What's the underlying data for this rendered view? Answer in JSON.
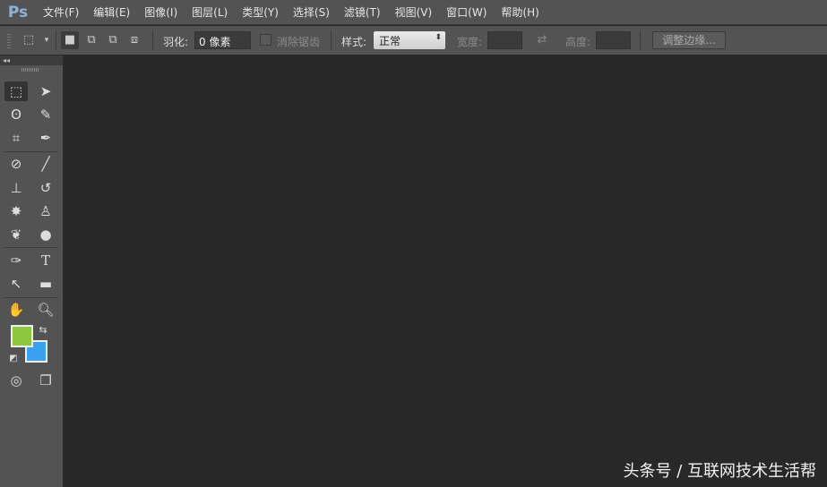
{
  "app": {
    "logo": "Ps"
  },
  "menu": [
    "文件(F)",
    "编辑(E)",
    "图像(I)",
    "图层(L)",
    "类型(Y)",
    "选择(S)",
    "滤镜(T)",
    "视图(V)",
    "窗口(W)",
    "帮助(H)"
  ],
  "options": {
    "feather_label": "羽化:",
    "feather_value": "0 像素",
    "antialias_label": "消除锯齿",
    "style_label": "样式:",
    "style_value": "正常",
    "width_label": "宽度:",
    "height_label": "高度:",
    "refine_edge": "调整边缘..."
  },
  "toolbox": {
    "collapse": "◂◂",
    "foreground_color": "#8dc63f",
    "background_color": "#3aa0f0"
  },
  "watermark": "头条号 / 互联网技术生活帮"
}
